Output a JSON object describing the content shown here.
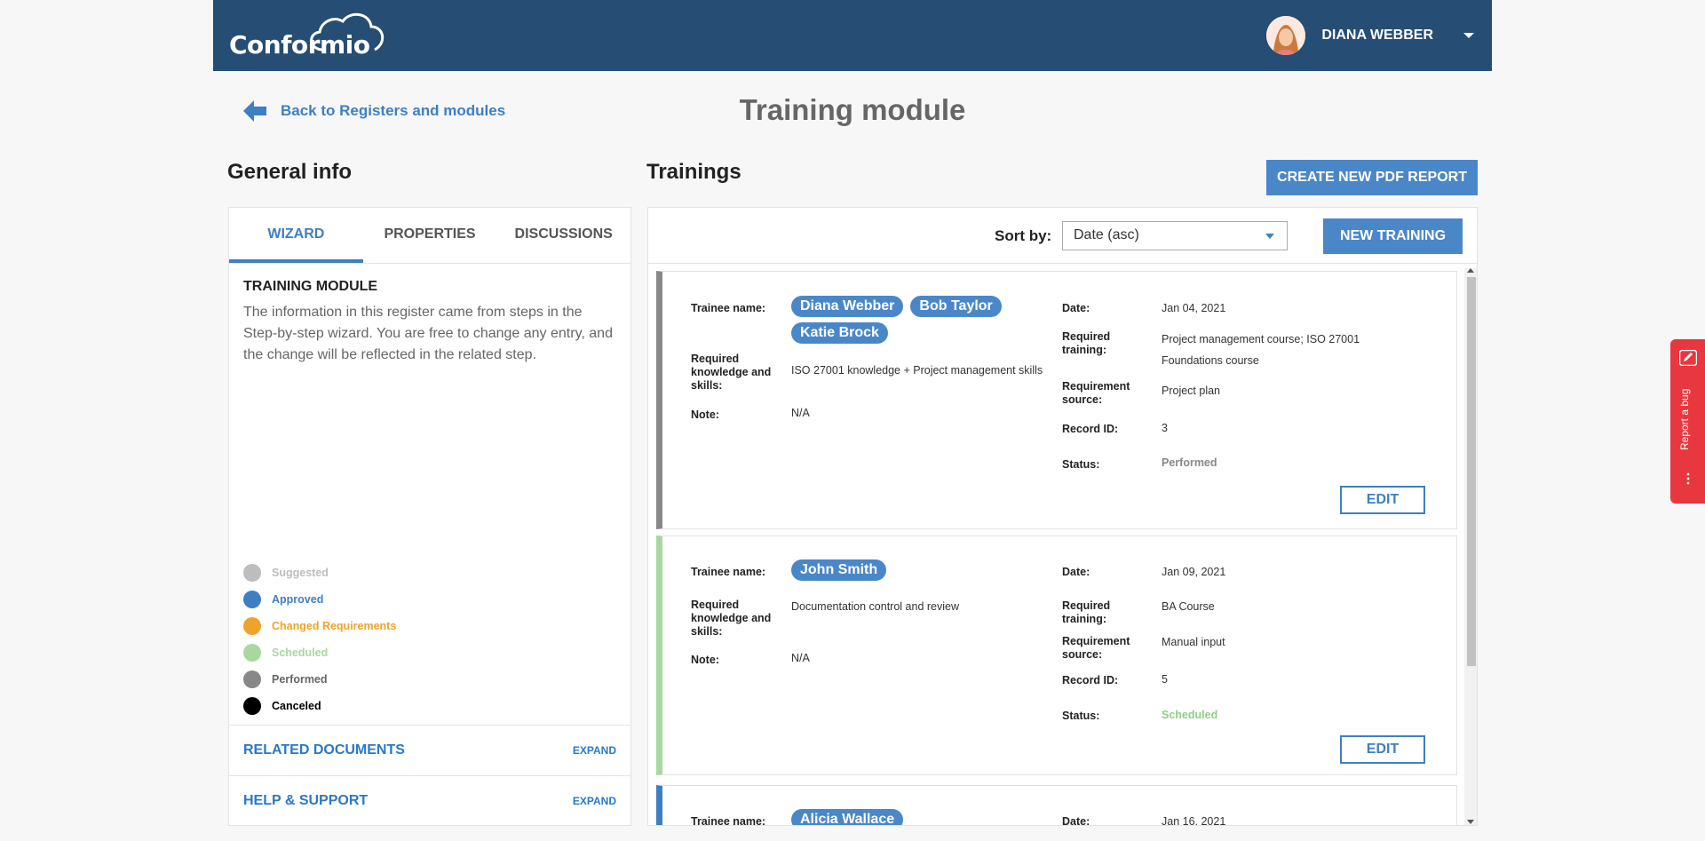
{
  "header": {
    "logo": "Conformio",
    "user_name": "DIANA WEBBER"
  },
  "nav": {
    "back_label": "Back to Registers and modules",
    "page_title": "Training module"
  },
  "general_info": {
    "heading": "General info",
    "tabs": [
      {
        "label": "WIZARD",
        "active": true
      },
      {
        "label": "PROPERTIES",
        "active": false
      },
      {
        "label": "DISCUSSIONS",
        "active": false
      }
    ],
    "module_title": "TRAINING MODULE",
    "module_desc": "The information in this register came from steps in the Step-by-step wizard. You are free to change any entry, and the change will be reflected in the related step.",
    "legend": [
      {
        "label": "Suggested",
        "color": "#bdbdbd"
      },
      {
        "label": "Approved",
        "color": "#3e7fc1"
      },
      {
        "label": "Changed Requirements",
        "color": "#f0a32a"
      },
      {
        "label": "Scheduled",
        "color": "#a8d8a0"
      },
      {
        "label": "Performed",
        "color": "#888888"
      },
      {
        "label": "Canceled",
        "color": "#000000"
      }
    ],
    "accordions": [
      {
        "title": "RELATED DOCUMENTS",
        "action": "EXPAND"
      },
      {
        "title": "HELP & SUPPORT",
        "action": "EXPAND"
      }
    ]
  },
  "trainings": {
    "heading": "Trainings",
    "pdf_button": "CREATE NEW PDF REPORT",
    "sort_label": "Sort by:",
    "sort_value": "Date (asc)",
    "new_button": "NEW TRAINING",
    "labels": {
      "trainee": "Trainee name:",
      "knowledge": "Required knowledge and skills:",
      "note": "Note:",
      "date": "Date:",
      "req_training": "Required training:",
      "req_source": "Requirement source:",
      "record_id": "Record ID:",
      "status": "Status:"
    },
    "edit_label": "EDIT",
    "records": [
      {
        "trainees": [
          "Diana Webber",
          "Bob Taylor",
          "Katie Brock"
        ],
        "knowledge": "ISO 27001 knowledge + Project management skills",
        "note": "N/A",
        "date": "Jan 04, 2021",
        "req_training": "Project management course; ISO 27001 Foundations course",
        "req_source": "Project plan",
        "record_id": "3",
        "status": "Performed",
        "status_color": "#888888",
        "border_color": "#888888"
      },
      {
        "trainees": [
          "John Smith"
        ],
        "knowledge": "Documentation control and review",
        "note": "N/A",
        "date": "Jan 09, 2021",
        "req_training": "BA Course",
        "req_source": "Manual input",
        "record_id": "5",
        "status": "Scheduled",
        "status_color": "#8fcf85",
        "border_color": "#a8d8a0"
      },
      {
        "trainees": [
          "Alicia Wallace"
        ],
        "date": "Jan 16, 2021",
        "border_color": "#3e7fc1"
      }
    ]
  },
  "report_bug": "Report a bug"
}
